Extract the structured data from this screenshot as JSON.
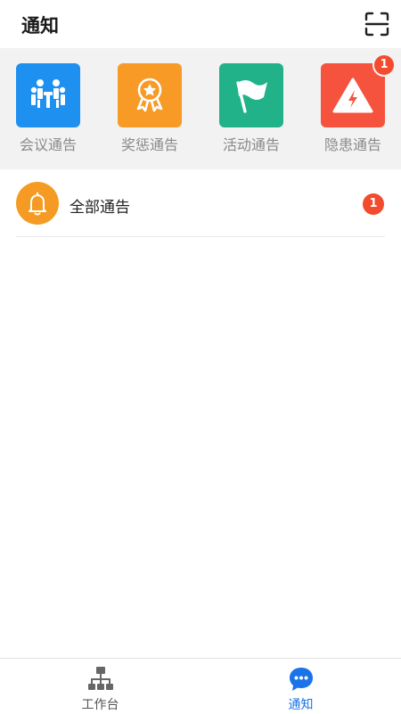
{
  "header": {
    "title": "通知"
  },
  "categories": [
    {
      "label": "会议通告",
      "icon": "meeting-icon",
      "color": "#1e90f0",
      "badge": ""
    },
    {
      "label": "奖惩通告",
      "icon": "award-icon",
      "color": "#f79a26",
      "badge": ""
    },
    {
      "label": "活动通告",
      "icon": "flag-icon",
      "color": "#21b28a",
      "badge": ""
    },
    {
      "label": "隐患通告",
      "icon": "hazard-warning-icon",
      "color": "#f5533d",
      "badge": "1"
    }
  ],
  "notice_list": [
    {
      "label": "全部通告",
      "icon": "bell-icon",
      "badge": "1"
    }
  ],
  "tabbar": {
    "tabs": [
      {
        "label": "工作台",
        "icon": "workbench-icon",
        "active": false
      },
      {
        "label": "通知",
        "icon": "chat-bubble-icon",
        "active": true
      }
    ],
    "active_color": "#1a73e8",
    "inactive_color": "#555555"
  }
}
